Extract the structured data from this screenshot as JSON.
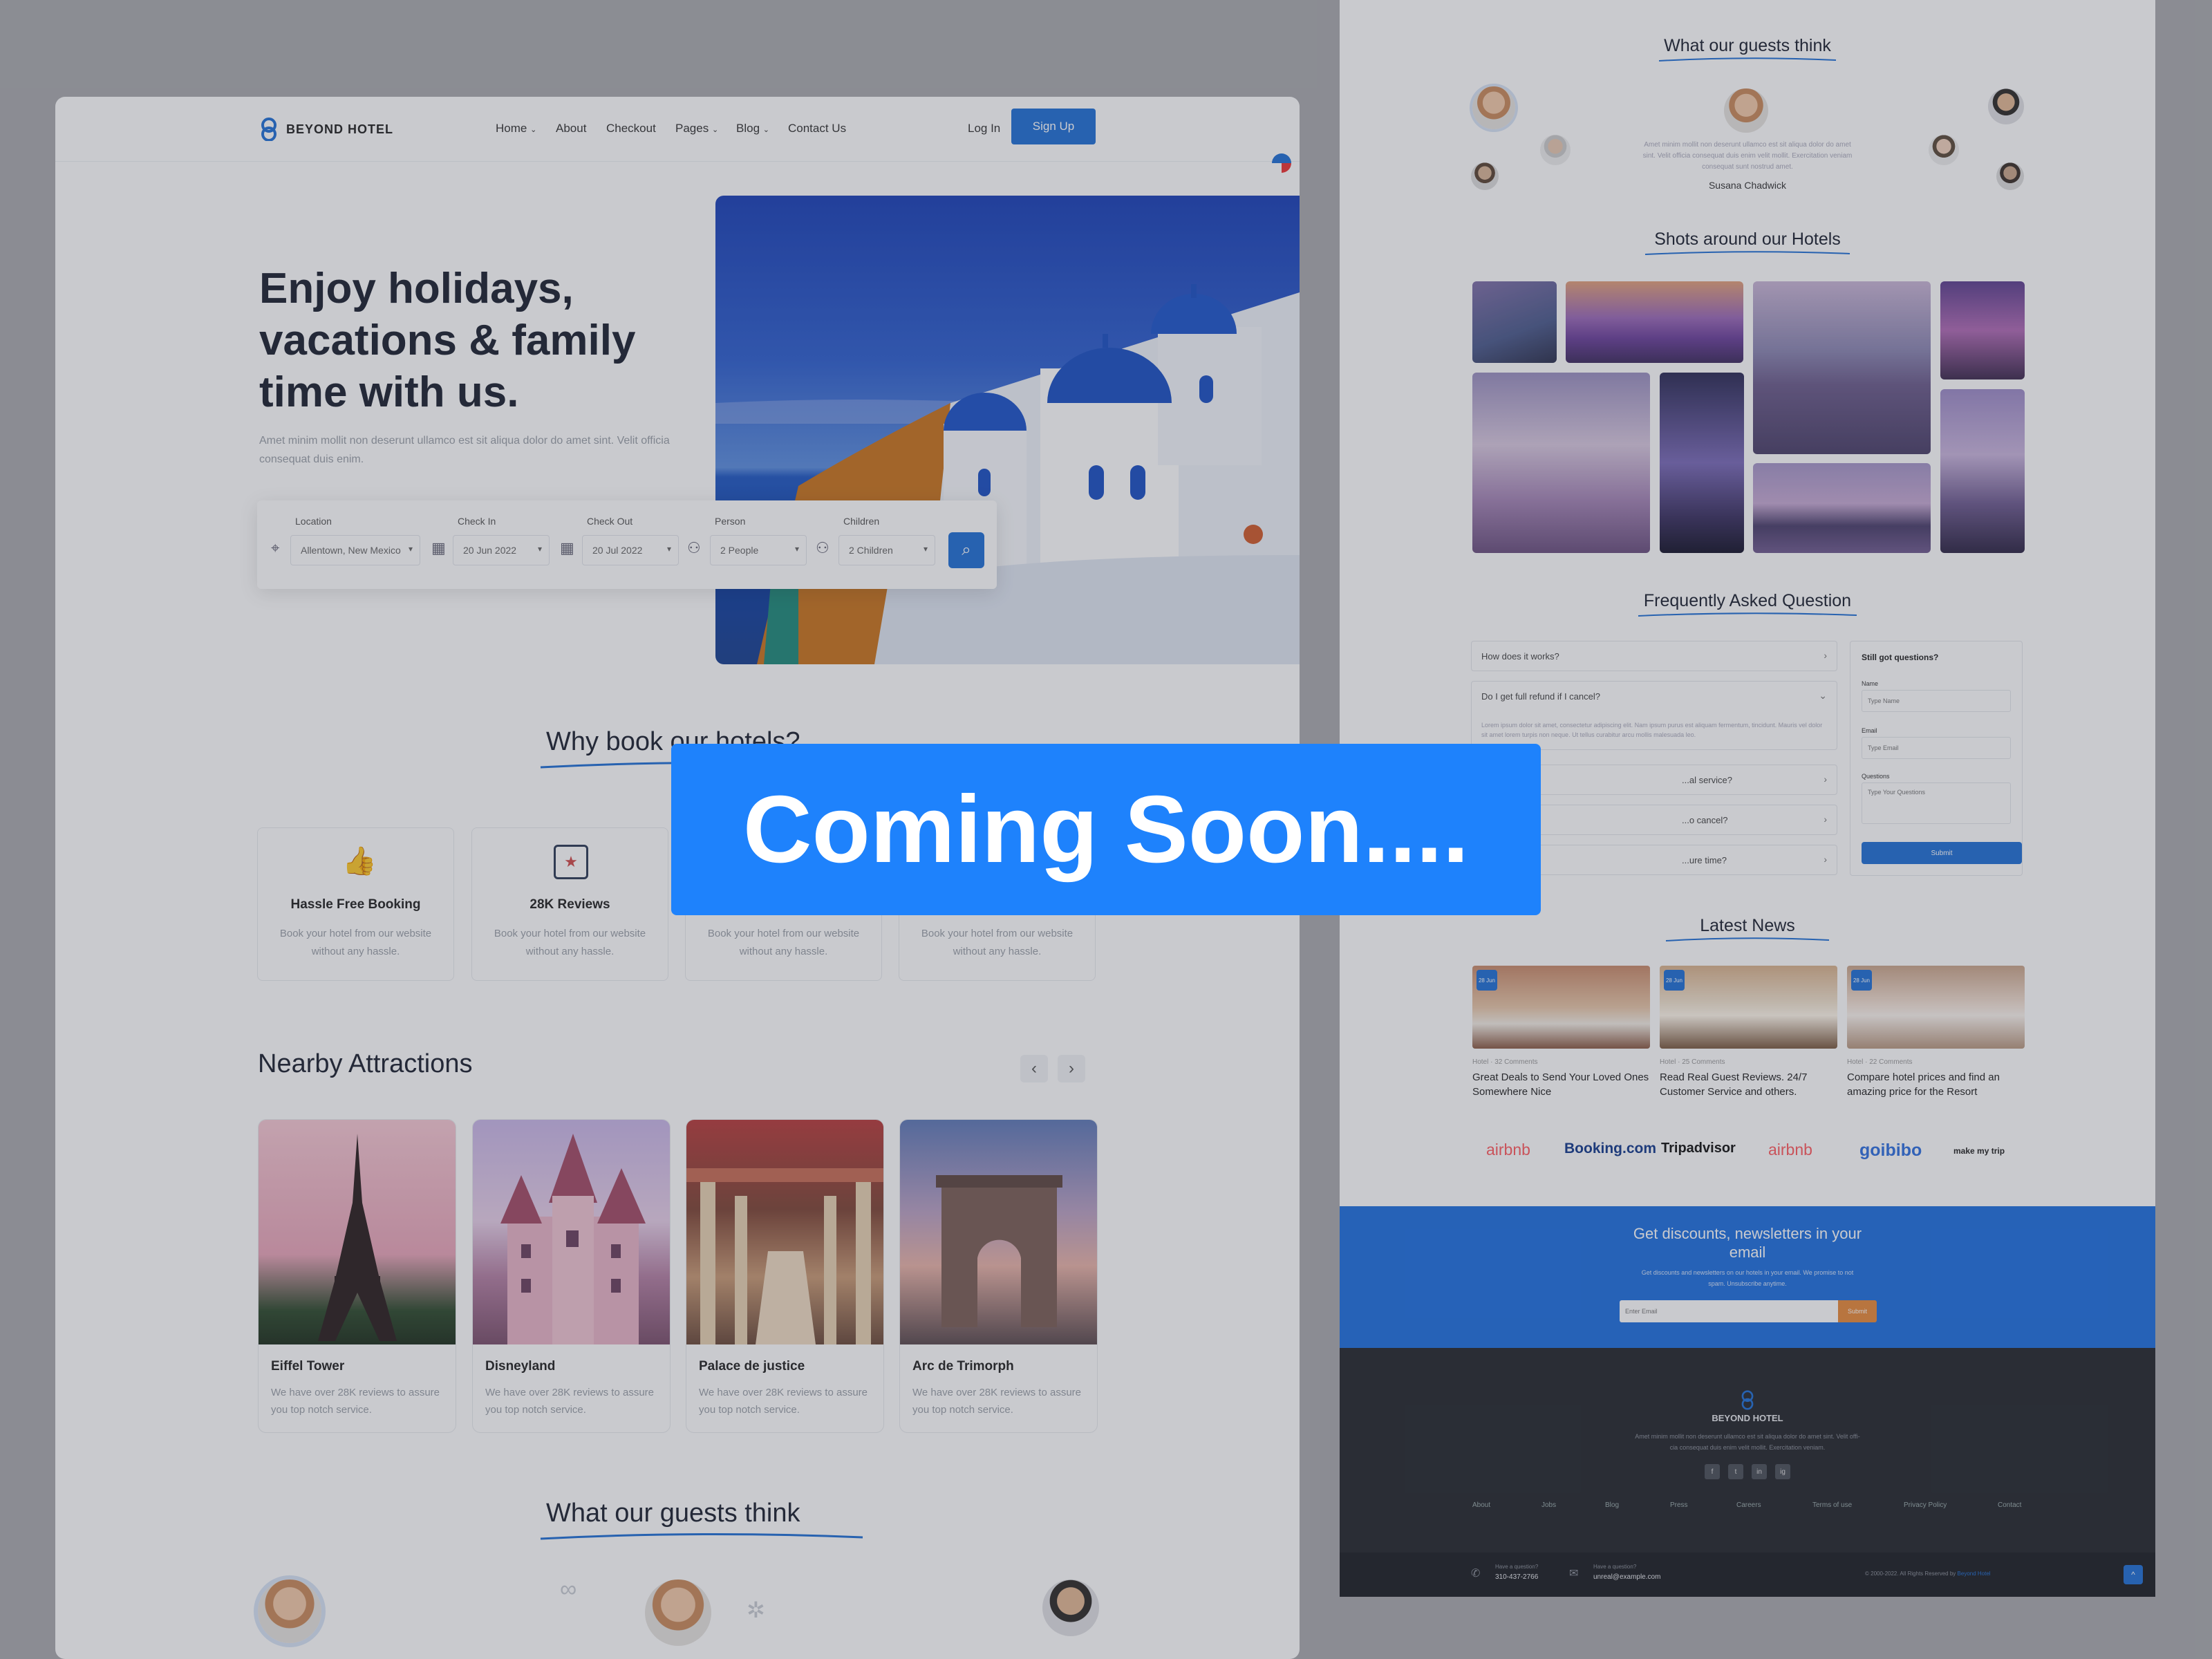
{
  "colors": {
    "primary": "#1f6fd6",
    "coming_soon": "#1e82fc",
    "footer_dark": "#23262c",
    "newsletter_blue": "#1e6fe0",
    "submit_orange": "#e8893a"
  },
  "brand": {
    "name": "BEYOND HOTEL"
  },
  "nav": {
    "items": [
      "Home",
      "About",
      "Checkout",
      "Pages",
      "Blog",
      "Contact Us"
    ],
    "login": "Log In",
    "signup": "Sign Up"
  },
  "hero": {
    "title_line1": "Enjoy holidays,",
    "title_line2": "vacations & family",
    "title_line3": "time with us.",
    "subtitle_line1": "Amet minim mollit non deserunt ullamco est sit aliqua dolor do amet sint. Velit officia",
    "subtitle_line2": "consequat duis enim."
  },
  "search": {
    "location": {
      "label": "Location",
      "value": "Allentown, New Mexico"
    },
    "checkin": {
      "label": "Check In",
      "value": "20 Jun 2022"
    },
    "checkout": {
      "label": "Check Out",
      "value": "20 Jul 2022"
    },
    "person": {
      "label": "Person",
      "value": "2 People"
    },
    "children": {
      "label": "Children",
      "value": "2 Children"
    }
  },
  "why_book": {
    "heading": "Why book our hotels?",
    "cards": [
      {
        "title": "Hassle Free Booking",
        "desc": "Book your hotel from our website without any hassle."
      },
      {
        "title": "28K Reviews",
        "desc": "Book your hotel from our website without any hassle."
      },
      {
        "title": "",
        "desc": "Book your hotel from our website without any hassle."
      },
      {
        "title": "",
        "desc": "Book your hotel from our website without any hassle."
      }
    ]
  },
  "attractions": {
    "heading": "Nearby Attractions",
    "prev": "‹",
    "next": "›",
    "cards": [
      {
        "title": "Eiffel Tower",
        "desc": "We have over 28K reviews to assure you top notch service."
      },
      {
        "title": "Disneyland",
        "desc": "We have over 28K reviews to assure you top notch service."
      },
      {
        "title": "Palace de justice",
        "desc": "We have over 28K reviews to assure you top notch service."
      },
      {
        "title": "Arc de Trimorph",
        "desc": "We have over 28K reviews to assure you top notch service."
      }
    ]
  },
  "guests": {
    "heading": "What our guests think",
    "quote": "Amet minim mollit non deserunt ullamco est sit aliqua dolor do amet sint. Velit officia consequat duis enim velit mollit. Exercitation veniam consequat sunt nostrud amet.",
    "name": "Susana Chadwick"
  },
  "shots": {
    "heading": "Shots around our Hotels"
  },
  "faq": {
    "heading": "Frequently Asked Question",
    "questions": [
      "How does it works?",
      "Do I get full refund if I cancel?",
      "...al service?",
      "...o cancel?",
      "...ure time?"
    ],
    "answer": "Lorem ipsum dolor sit amet, consectetur adipiscing elit. Nam ipsum purus est aliquam fermentum, tincidunt. Mauris vel dolor sit amet lorem turpis non neque. Ut tellus curabitur arcu mollis malesuada leo.",
    "form": {
      "title": "Still got questions?",
      "name_label": "Name",
      "name_placeholder": "Type Name",
      "email_label": "Email",
      "email_placeholder": "Type Email",
      "q_label": "Questions",
      "q_placeholder": "Type Your Questions",
      "submit": "Submit"
    }
  },
  "news": {
    "heading": "Latest News",
    "items": [
      {
        "date": "28 Jun",
        "meta": "Hotel  ·  32 Comments",
        "title": "Great Deals to Send Your Loved Ones Somewhere Nice"
      },
      {
        "date": "28 Jun",
        "meta": "Hotel  ·  25 Comments",
        "title": "Read Real Guest Reviews. 24/7 Customer Service and others."
      },
      {
        "date": "28 Jun",
        "meta": "Hotel  ·  22 Comments",
        "title": "Compare hotel prices and find an amazing price for the Resort"
      }
    ]
  },
  "partners": [
    "airbnb",
    "Booking.com",
    "Tripadvisor",
    "airbnb",
    "goibibo",
    "make my trip"
  ],
  "newsletter": {
    "title_line1": "Get discounts, newsletters in your",
    "title_line2": "email",
    "desc_line1": "Get discounts and newsletters on our hotels in your email. We promise to not",
    "desc_line2": "spam. Unsubscribe anytime.",
    "placeholder": "Enter Email",
    "submit": "Submit"
  },
  "footer": {
    "brand": "BEYOND HOTEL",
    "desc_line1": "Amet minim mollit non deserunt ullamco est sit aliqua dolor do amet sint. Velit offi-",
    "desc_line2": "cia consequat duis enim velit mollit. Exercitation veniam.",
    "social": [
      "f",
      "t",
      "in",
      "ig"
    ],
    "links": [
      "About",
      "Jobs",
      "Blog",
      "Press",
      "Careers",
      "Terms of use",
      "Privacy Policy",
      "Contact"
    ],
    "phone_label": "Have a question?",
    "phone": "310-437-2766",
    "email_label": "Have a question?",
    "email": "unreal@example.com",
    "copyright": "© 2000-2022. All Rights Reserved by",
    "copyright_brand": "Beyond Hotel",
    "to_top": "^"
  },
  "overlay": {
    "coming_soon": "Coming Soon...."
  }
}
